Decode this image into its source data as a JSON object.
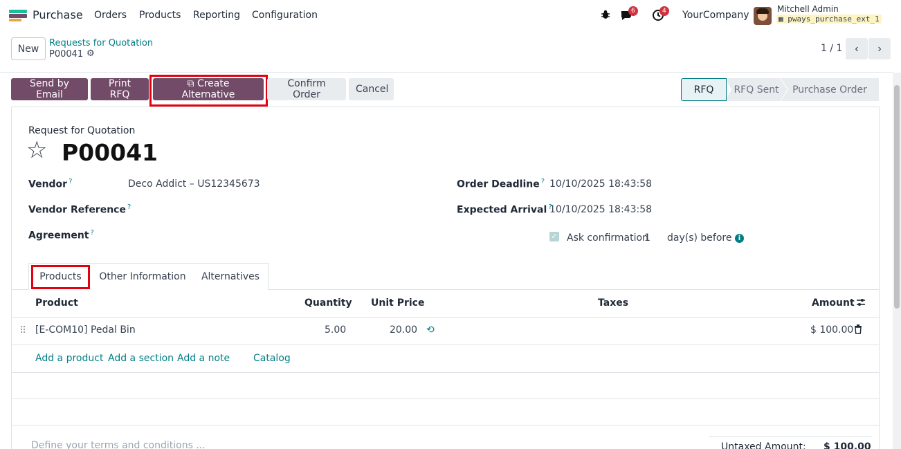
{
  "navbar": {
    "app_name": "Purchase",
    "menus": [
      "Orders",
      "Products",
      "Reporting",
      "Configuration"
    ],
    "discuss_badge": "6",
    "activity_badge": "4",
    "company": "YourCompany",
    "user_name": "Mitchell Admin",
    "database": "pways_purchase_ext_1",
    "icons": {
      "debug": "bug-icon",
      "discuss": "chat-icon",
      "activity": "clock-icon"
    }
  },
  "control_panel": {
    "new_label": "New",
    "breadcrumb_parent": "Requests for Quotation",
    "record_name": "P00041",
    "pager": "1 / 1"
  },
  "actions": {
    "send_email": "Send by Email",
    "print_rfq": "Print RFQ",
    "create_alternative": "Create Alternative",
    "confirm_order": "Confirm Order",
    "cancel": "Cancel"
  },
  "status_bar": {
    "stages": [
      "RFQ",
      "RFQ Sent",
      "Purchase Order"
    ],
    "current": "RFQ"
  },
  "form": {
    "doc_type": "Request for Quotation",
    "doc_name": "P00041",
    "vendor_label": "Vendor",
    "vendor_value": "Deco Addict – US12345673",
    "vendor_ref_label": "Vendor Reference",
    "agreement_label": "Agreement",
    "order_deadline_label": "Order Deadline",
    "order_deadline_value": "10/10/2025 18:43:58",
    "expected_arrival_label": "Expected Arrival",
    "expected_arrival_value": "10/10/2025 18:43:58",
    "ask_confirmation_label": "Ask confirmation",
    "ask_confirmation_days": "1",
    "days_before_label": "day(s) before",
    "help_mark": "?"
  },
  "tabs": [
    "Products",
    "Other Information",
    "Alternatives"
  ],
  "lines_table": {
    "columns": {
      "product": "Product",
      "quantity": "Quantity",
      "unit_price": "Unit Price",
      "taxes": "Taxes",
      "amount": "Amount"
    },
    "rows": [
      {
        "product": "[E-COM10] Pedal Bin",
        "quantity": "5.00",
        "unit_price": "20.00",
        "taxes": "",
        "amount": "$ 100.00"
      }
    ],
    "add_product": "Add a product",
    "add_section": "Add a section",
    "add_note": "Add a note",
    "catalog": "Catalog"
  },
  "footer": {
    "terms_placeholder": "Define your terms and conditions ...",
    "untaxed_label": "Untaxed Amount:",
    "untaxed_value": "$ 100.00"
  },
  "colors": {
    "primary": "#714b67",
    "link": "#017e84",
    "highlight": "#e3000f"
  }
}
